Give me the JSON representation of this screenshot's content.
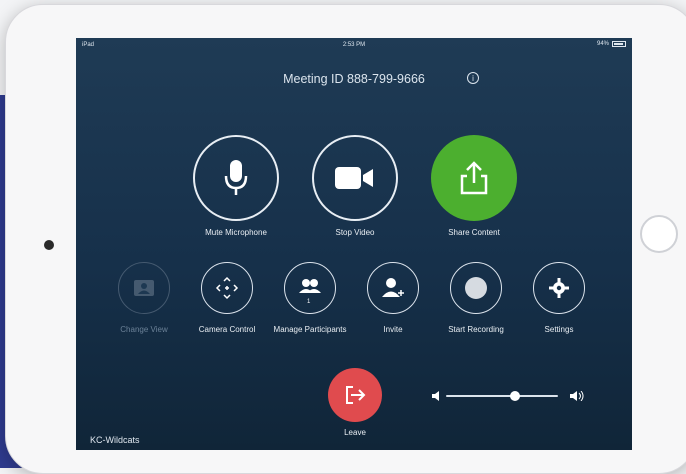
{
  "status_bar": {
    "carrier": "iPad",
    "time": "2:53 PM",
    "battery": "94%"
  },
  "meeting": {
    "id_text": "Meeting ID 888-799-9666",
    "room_name": "KC-Wildcats"
  },
  "primary_actions": [
    {
      "label": "Mute Microphone",
      "icon": "microphone-icon"
    },
    {
      "label": "Stop Video",
      "icon": "video-camera-icon"
    },
    {
      "label": "Share Content",
      "icon": "share-upload-icon",
      "color": "#4caf2f"
    }
  ],
  "secondary_actions": [
    {
      "label": "Change View",
      "icon": "gallery-view-icon",
      "disabled": true
    },
    {
      "label": "Camera Control",
      "icon": "camera-control-arrows-icon"
    },
    {
      "label": "Manage Participants",
      "icon": "participants-icon",
      "badge": "1"
    },
    {
      "label": "Invite",
      "icon": "invite-user-icon"
    },
    {
      "label": "Start Recording",
      "icon": "record-icon"
    },
    {
      "label": "Settings",
      "icon": "gear-icon"
    }
  ],
  "leave": {
    "label": "Leave",
    "icon": "leave-exit-icon",
    "color": "#e04b4e"
  },
  "volume": {
    "level": 0.62
  }
}
